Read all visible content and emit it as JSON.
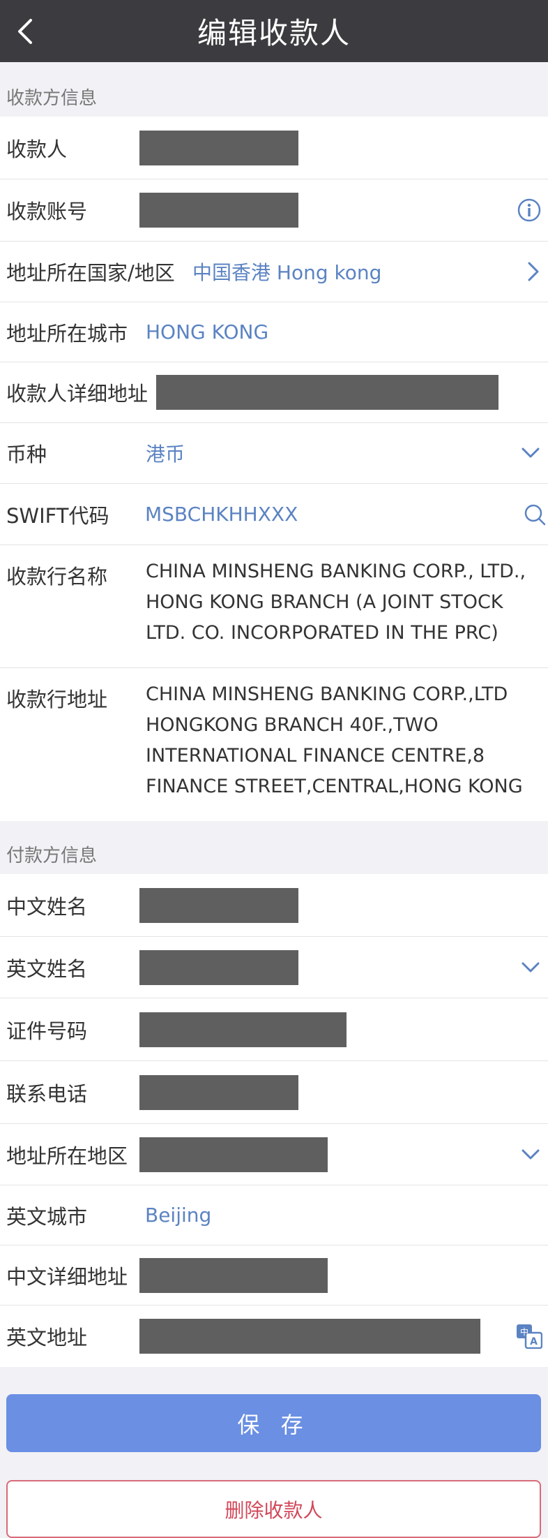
{
  "nav": {
    "title": "编辑收款人"
  },
  "payee": {
    "section_title": "收款方信息",
    "name_label": "收款人",
    "account_label": "收款账号",
    "country_label": "地址所在国家/地区",
    "country_value": "中国香港  Hong kong",
    "city_label": "地址所在城市",
    "city_value": "HONG KONG",
    "address_label": "收款人详细地址",
    "currency_label": "币种",
    "currency_value": "港币",
    "swift_label": "SWIFT代码",
    "swift_value": "MSBCHKHHXXX",
    "bank_name_label": "收款行名称",
    "bank_name_value": "CHINA MINSHENG BANKING CORP., LTD., HONG KONG BRANCH (A JOINT STOCK LTD. CO. INCORPORATED IN THE PRC)",
    "bank_address_label": "收款行地址",
    "bank_address_value": "CHINA MINSHENG BANKING CORP.,LTD HONGKONG BRANCH 40F.,TWO INTERNATIONAL FINANCE CENTRE,8 FINANCE STREET,CENTRAL,HONG KONG"
  },
  "payer": {
    "section_title": "付款方信息",
    "cn_name_label": "中文姓名",
    "en_name_label": "英文姓名",
    "id_label": "证件号码",
    "phone_label": "联系电话",
    "region_label": "地址所在地区",
    "en_city_label": "英文城市",
    "en_city_value": "Beijing",
    "cn_address_label": "中文详细地址",
    "en_address_label": "英文地址"
  },
  "buttons": {
    "save": "保 存",
    "delete": "删除收款人"
  },
  "icons": {
    "back": "back-chevron-icon",
    "info": "info-icon",
    "chevron_right": "chevron-right-icon",
    "chevron_down": "chevron-down-icon",
    "search": "search-icon",
    "translate": "translate-icon"
  },
  "colors": {
    "navbar": "#3c3b3f",
    "accent_blue": "#5b83c2",
    "save_button": "#6a8fe3",
    "delete_text": "#d2485a",
    "masked_field": "#5f5f5f"
  }
}
